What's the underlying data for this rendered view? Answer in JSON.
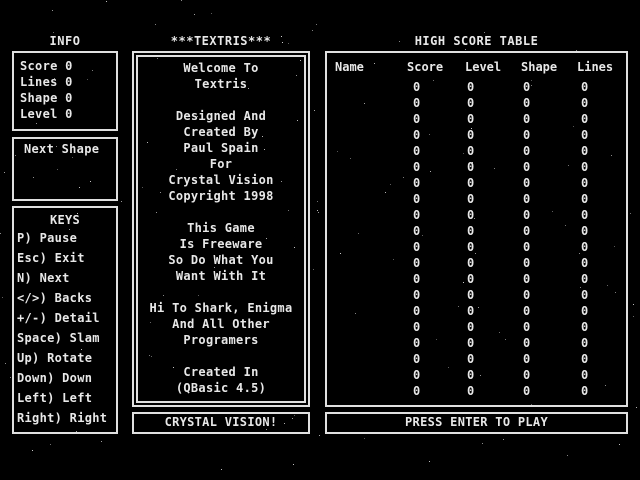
{
  "info": {
    "title": "INFO",
    "rows": [
      "Score 0",
      "Lines 0",
      "Shape 0",
      "Level 0"
    ]
  },
  "next_shape": {
    "label": "Next Shape"
  },
  "keys": {
    "title": "KEYS",
    "items": [
      "P) Pause",
      "Esc) Exit",
      "N) Next",
      "</>) Backs",
      "+/-) Detail",
      "Space) Slam",
      "Up) Rotate",
      "Down) Down",
      "Left) Left",
      "Right) Right"
    ]
  },
  "center": {
    "title": "***TEXTRIS***",
    "lines": [
      "Welcome To",
      "Textris",
      "",
      "Designed And",
      "Created By",
      "Paul Spain",
      "For",
      "Crystal Vision",
      "Copyright 1998",
      "",
      "This Game",
      "Is Freeware",
      "So Do What You",
      "Want With It",
      "",
      "Hi To Shark, Enigma",
      "And All Other",
      "Programers",
      "",
      "Created In",
      "(QBasic 4.5)"
    ],
    "footer": "CRYSTAL VISION!"
  },
  "high_scores": {
    "title": "HIGH SCORE TABLE",
    "columns": [
      "Name",
      "Score",
      "Level",
      "Shape",
      "Lines"
    ],
    "rows": [
      [
        "",
        "0",
        "0",
        "0",
        "0"
      ],
      [
        "",
        "0",
        "0",
        "0",
        "0"
      ],
      [
        "",
        "0",
        "0",
        "0",
        "0"
      ],
      [
        "",
        "0",
        "0",
        "0",
        "0"
      ],
      [
        "",
        "0",
        "0",
        "0",
        "0"
      ],
      [
        "",
        "0",
        "0",
        "0",
        "0"
      ],
      [
        "",
        "0",
        "0",
        "0",
        "0"
      ],
      [
        "",
        "0",
        "0",
        "0",
        "0"
      ],
      [
        "",
        "0",
        "0",
        "0",
        "0"
      ],
      [
        "",
        "0",
        "0",
        "0",
        "0"
      ],
      [
        "",
        "0",
        "0",
        "0",
        "0"
      ],
      [
        "",
        "0",
        "0",
        "0",
        "0"
      ],
      [
        "",
        "0",
        "0",
        "0",
        "0"
      ],
      [
        "",
        "0",
        "0",
        "0",
        "0"
      ],
      [
        "",
        "0",
        "0",
        "0",
        "0"
      ],
      [
        "",
        "0",
        "0",
        "0",
        "0"
      ],
      [
        "",
        "0",
        "0",
        "0",
        "0"
      ],
      [
        "",
        "0",
        "0",
        "0",
        "0"
      ],
      [
        "",
        "0",
        "0",
        "0",
        "0"
      ],
      [
        "",
        "0",
        "0",
        "0",
        "0"
      ]
    ],
    "footer": "PRESS ENTER TO PLAY"
  }
}
